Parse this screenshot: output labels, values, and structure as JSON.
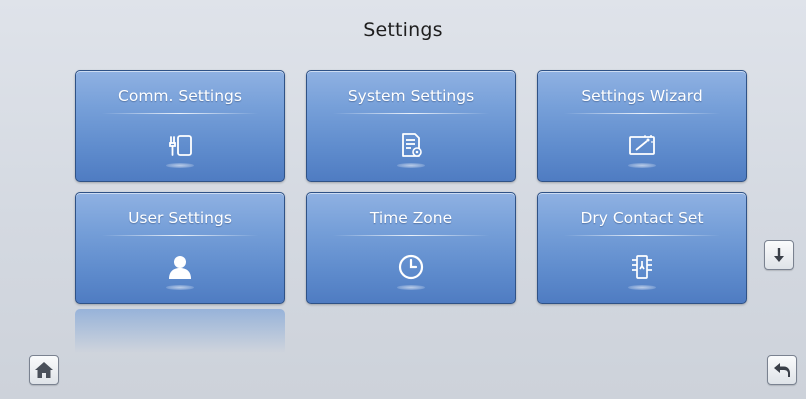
{
  "page": {
    "title": "Settings"
  },
  "tiles": [
    {
      "label": "Comm. Settings",
      "icon": "comm-settings-icon"
    },
    {
      "label": "System Settings",
      "icon": "system-settings-icon"
    },
    {
      "label": "Settings Wizard",
      "icon": "settings-wizard-icon"
    },
    {
      "label": "User Settings",
      "icon": "user-icon"
    },
    {
      "label": "Time Zone",
      "icon": "clock-icon"
    },
    {
      "label": "Dry Contact Set",
      "icon": "dry-contact-icon"
    }
  ],
  "controls": {
    "scroll_down": "arrow-down-icon",
    "home": "home-icon",
    "back": "back-icon"
  },
  "colors": {
    "tile_top": "#8fb1e2",
    "tile_bottom": "#4f7cc2",
    "tile_border": "#2f5286",
    "background": "#d8dce3"
  }
}
